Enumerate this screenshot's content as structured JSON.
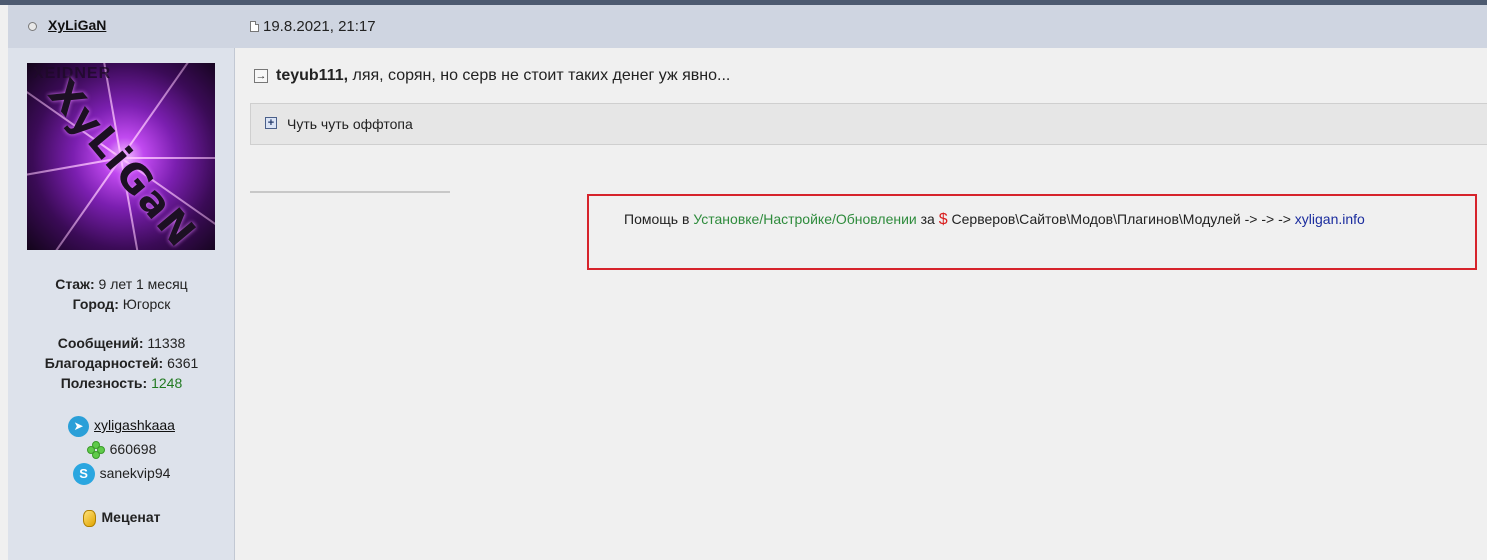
{
  "post": {
    "username": "XyLiGaN",
    "date": "19.8.2021, 21:17",
    "reply_to": "teyub111,",
    "message": " ляя, сорян, но серв не стоит таких денег уж явно..."
  },
  "spoiler": {
    "label": "Чуть чуть оффтопа"
  },
  "profile": {
    "tenure_label": "Стаж:",
    "tenure_value": " 9 лет 1 месяц",
    "city_label": "Город:",
    "city_value": " Югорск",
    "messages_label": "Сообщений:",
    "messages_value": " 11338",
    "thanks_label": "Благодарностей:",
    "thanks_value": " 6361",
    "usefulness_label": "Полезность:",
    "usefulness_value": " 1248",
    "telegram": "xyligashkaaa",
    "icq": "660698",
    "skype": "sanekvip94",
    "rank": "Меценат"
  },
  "signature": {
    "prefix": "Помощь в ",
    "services": "Установке/Настройке/Обновлении",
    "for": " за ",
    "dollar": "$",
    "targets": " Серверов\\Сайтов\\Модов\\Плагинов\\Модулей -> -> -> ",
    "link": "xyligan.info"
  },
  "colors": {
    "header_bg": "#cfd5e1",
    "sidebar_bg": "#dde2eb",
    "highlight_border": "#d6232b",
    "link_blue": "#1a2c9e",
    "green_text": "#2e8b3c"
  }
}
